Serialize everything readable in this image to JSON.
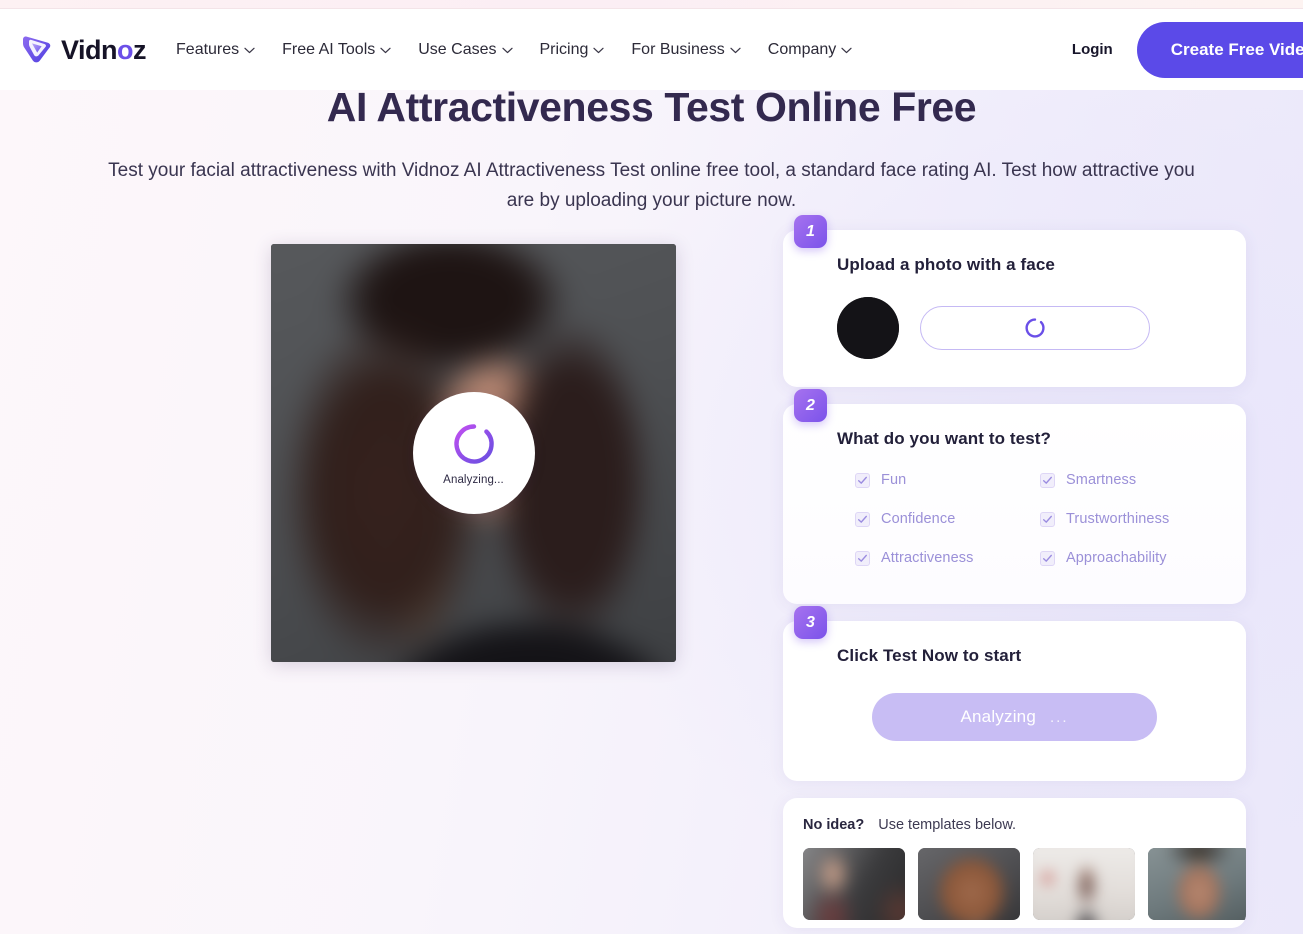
{
  "brand": {
    "name_prefix": "Vidn",
    "name_accent": "o",
    "name_suffix": "z",
    "accent_color": "#6b4fe8"
  },
  "header": {
    "nav": [
      {
        "label": "Features",
        "has_dropdown": true
      },
      {
        "label": "Free AI Tools",
        "has_dropdown": true
      },
      {
        "label": "Use Cases",
        "has_dropdown": true
      },
      {
        "label": "Pricing",
        "has_dropdown": true
      },
      {
        "label": "For Business",
        "has_dropdown": true
      },
      {
        "label": "Company",
        "has_dropdown": true
      }
    ],
    "login_label": "Login",
    "cta_label": "Create Free Video",
    "cta_color": "#5b4ae8"
  },
  "hero": {
    "title": "AI Attractiveness Test Online Free",
    "subtitle": "Test your facial attractiveness with Vidnoz AI Attractiveness Test online free tool, a standard face rating AI. Test how attractive you are by uploading your picture now."
  },
  "preview": {
    "status_label": "Analyzing...",
    "spinner_color": "#7b4fe8"
  },
  "steps": [
    {
      "number": "1",
      "title": "Upload a photo with a face",
      "upload_state": "loading"
    },
    {
      "number": "2",
      "title": "What do you want to test?",
      "options": [
        {
          "label": "Fun",
          "checked": true
        },
        {
          "label": "Smartness",
          "checked": true
        },
        {
          "label": "Confidence",
          "checked": true
        },
        {
          "label": "Trustworthiness",
          "checked": true
        },
        {
          "label": "Attractiveness",
          "checked": true
        },
        {
          "label": "Approachability",
          "checked": true
        }
      ]
    },
    {
      "number": "3",
      "title": "Click Test Now to start",
      "button_label": "Analyzing",
      "button_dots": "...",
      "button_disabled": true
    }
  ],
  "templates": {
    "lead": "No idea?",
    "hint": "Use templates below.",
    "items": [
      {
        "alt": "template-portrait-1"
      },
      {
        "alt": "template-portrait-2"
      },
      {
        "alt": "template-portrait-3"
      },
      {
        "alt": "template-portrait-4"
      }
    ]
  }
}
